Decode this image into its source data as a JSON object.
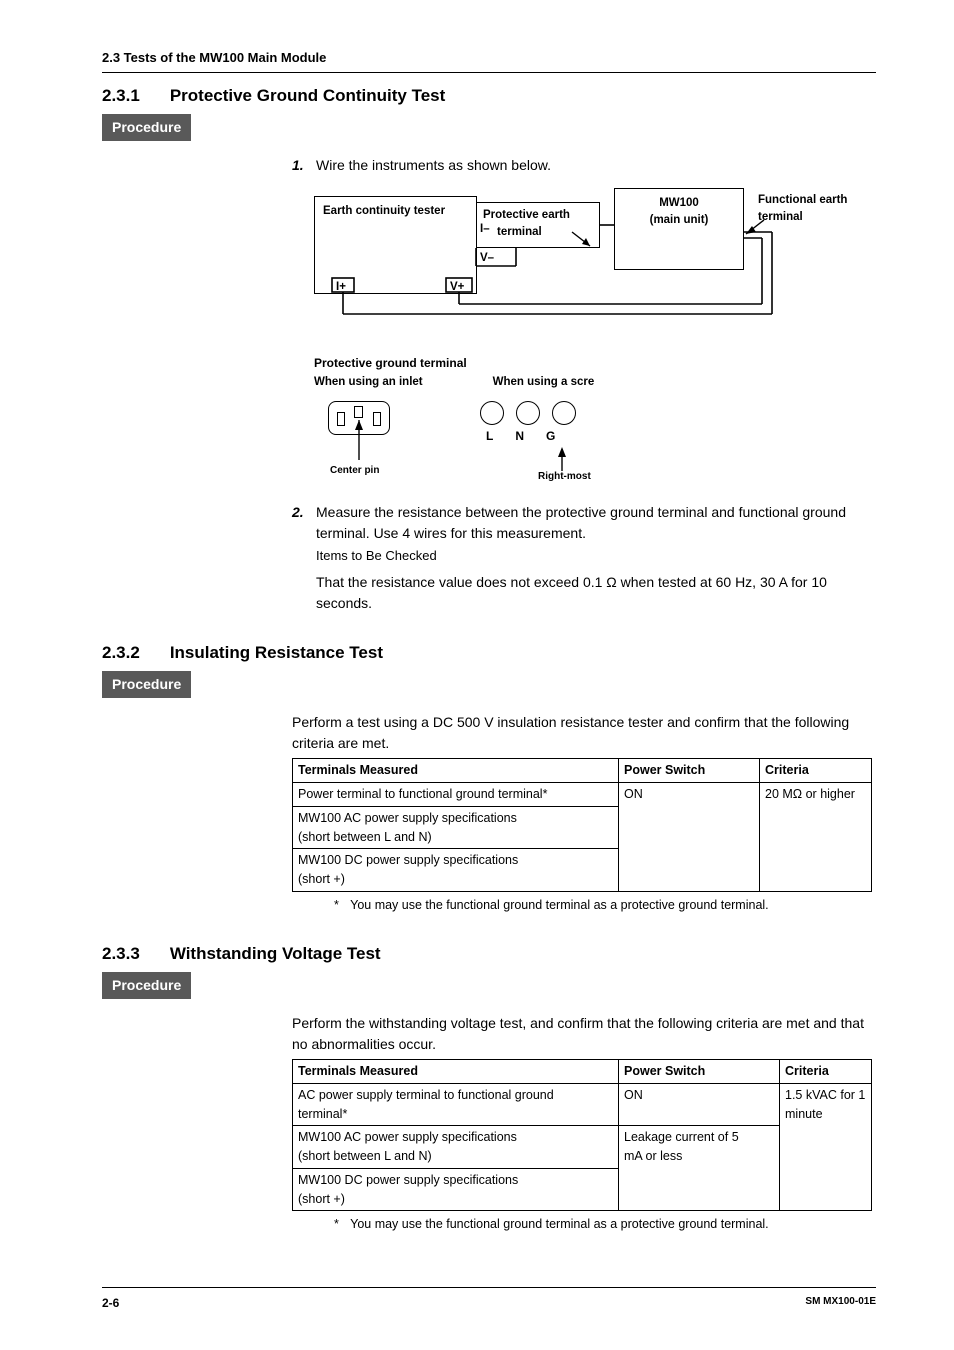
{
  "header": "2.3  Tests of the MW100 Main Module",
  "s231": {
    "num": "2.3.1",
    "title": "Protective Ground Continuity Test",
    "procedure": "Procedure",
    "step1_num": "1.",
    "step1_txt": "Wire the instruments as shown below.",
    "diagram": {
      "earth_tester": "Earth continuity tester",
      "protective_terminal_l1": "Protective earth",
      "protective_terminal_l2": "terminal",
      "mw100_l1": "MW100",
      "mw100_l2": "(main unit)",
      "func_terminal": "Functional earth terminal",
      "I_minus": "I–",
      "V_minus": "V–",
      "I_plus": "I+",
      "V_plus": "V+"
    },
    "pg_title": "Protective ground terminal",
    "pg_inlet": "When using an inlet",
    "pg_screw": "When using a scre",
    "center_pin": "Center pin",
    "L": "L",
    "N": "N",
    "G": "G",
    "rightmost": "Right-most",
    "step2_num": "2.",
    "step2_txt": "Measure the resistance between the protective ground terminal and functional ground terminal. Use 4 wires for this measurement.",
    "step2_items": "Items to Be Checked",
    "step2_criteria": "That the resistance value does not exceed 0.1 Ω when tested at 60 Hz, 30 A for 10 seconds."
  },
  "s232": {
    "num": "2.3.2",
    "title": "Insulating Resistance Test",
    "procedure": "Procedure",
    "intro": "Perform a test using a DC 500 V insulation resistance tester and confirm that the following criteria are met.",
    "table": {
      "h1": "Terminals Measured",
      "h2": "Power Switch",
      "h3": "Criteria",
      "r1c1": "Power terminal to functional ground terminal*",
      "r1c2": "ON",
      "r1c3": "20 MΩ or higher",
      "r2c1a": "MW100 AC power supply specifications",
      "r2c1b": "(short between L and N)",
      "r3c1a": "MW100 DC power supply specifications",
      "r3c1b": "(short +)"
    },
    "footnote_star": "*",
    "footnote": "You may use the functional ground terminal as a protective ground terminal."
  },
  "s233": {
    "num": "2.3.3",
    "title": "Withstanding Voltage Test",
    "procedure": "Procedure",
    "intro": "Perform the withstanding voltage test, and confirm that the following criteria are met and that no abnormalities occur.",
    "table": {
      "h1": "Terminals Measured",
      "h2": "Power Switch",
      "h3": "Criteria",
      "r1c1a": "AC power supply terminal to functional ground",
      "r1c1b": "terminal*",
      "r1c2": "ON",
      "r1c3a": "1.5 kVAC for 1",
      "r1c3b": "minute",
      "r2c1a": "MW100 AC power supply specifications",
      "r2c1b": "(short between L and N)",
      "r2c2a": "Leakage current of 5",
      "r2c2b": "mA or less",
      "r3c1a": "MW100 DC power supply specifications",
      "r3c1b": "(short +)"
    },
    "footnote_star": "*",
    "footnote": "You may use the functional ground terminal as a protective ground terminal."
  },
  "footer": {
    "page": "2-6",
    "doc": "SM MX100-01E"
  }
}
